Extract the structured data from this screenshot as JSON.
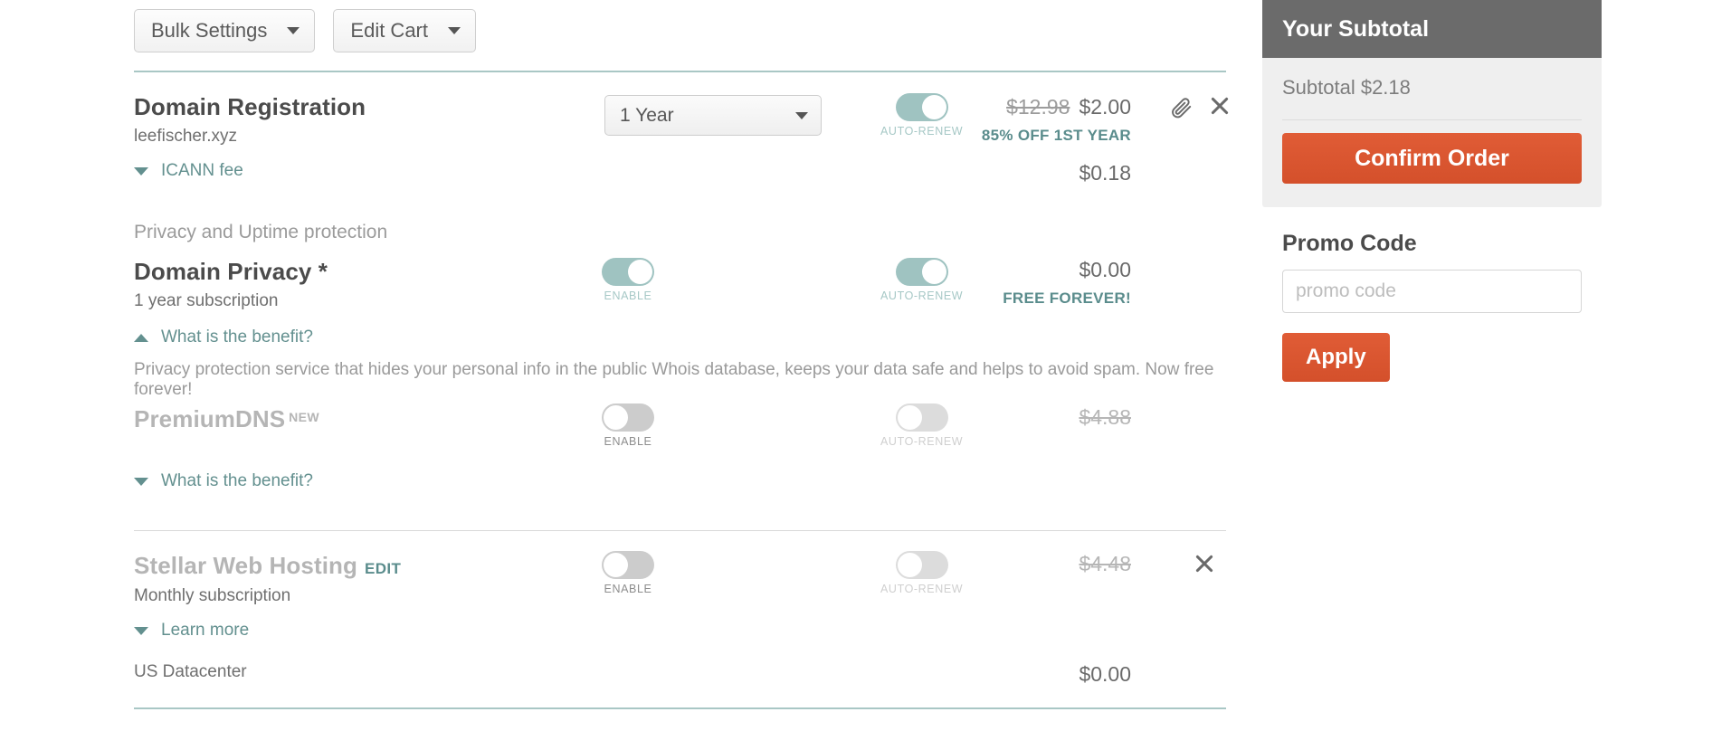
{
  "toolbar": {
    "bulk_settings": "Bulk Settings",
    "edit_cart": "Edit Cart"
  },
  "cart": {
    "domain": {
      "title": "Domain Registration",
      "name": "leefischer.xyz",
      "term_selected": "1 Year",
      "auto_renew_label": "AUTO-RENEW",
      "price_old": "$12.98",
      "price_new": "$2.00",
      "price_note": "85% OFF 1ST YEAR",
      "icann_link": "ICANN fee",
      "icann_price": "$0.18"
    },
    "protection_section_label": "Privacy and Uptime protection",
    "privacy": {
      "title": "Domain Privacy *",
      "sub": "1 year subscription",
      "enable_label": "ENABLE",
      "auto_renew_label": "AUTO-RENEW",
      "price": "$0.00",
      "price_note": "FREE FOREVER!",
      "benefit_link": "What is the benefit?",
      "benefit_text": "Privacy protection service that hides your personal info in the public Whois database, keeps your data safe and helps to avoid spam. Now free forever!"
    },
    "premiumdns": {
      "title": "PremiumDNS",
      "badge": "NEW",
      "enable_label": "ENABLE",
      "auto_renew_label": "AUTO-RENEW",
      "price": "$4.88",
      "benefit_link": "What is the benefit?"
    },
    "hosting": {
      "title": "Stellar Web Hosting",
      "edit_label": "EDIT",
      "sub": "Monthly subscription",
      "enable_label": "ENABLE",
      "auto_renew_label": "AUTO-RENEW",
      "price": "$4.48",
      "learn_more_link": "Learn more",
      "datacenter_label": "US Datacenter",
      "datacenter_price": "$0.00"
    }
  },
  "sidebar": {
    "subtotal_title": "Your Subtotal",
    "subtotal_line": "Subtotal $2.18",
    "confirm_label": "Confirm Order",
    "promo_title": "Promo Code",
    "promo_placeholder": "promo code",
    "promo_value": "",
    "apply_label": "Apply"
  },
  "colors": {
    "teal": "#63908f",
    "toggle_on": "#9fc3c1",
    "orange": "#d4502b",
    "header_gray": "#6b6b6b"
  }
}
